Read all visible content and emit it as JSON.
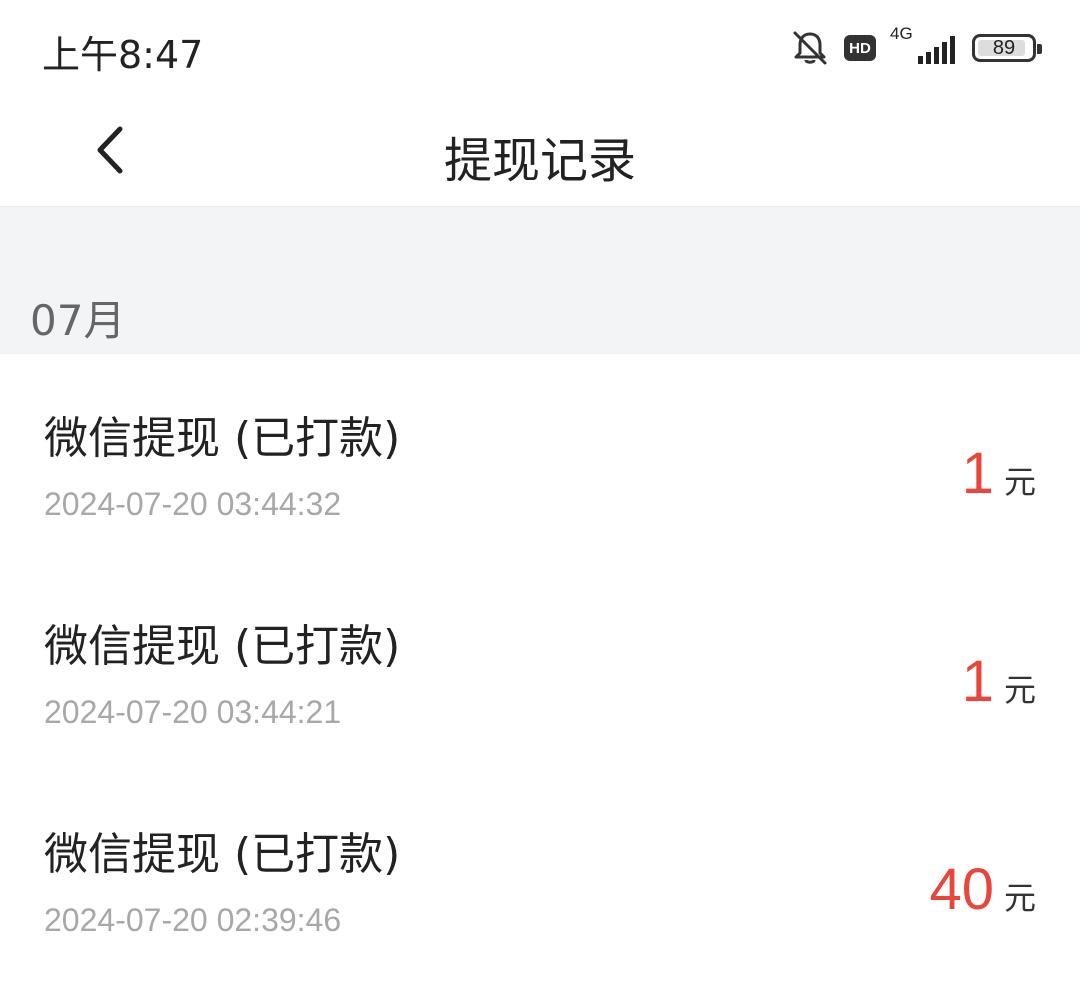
{
  "status_bar": {
    "time": "上午8:47",
    "hd_label": "HD",
    "network_label": "4G",
    "battery_level": "89",
    "icons": [
      "bell-muted-icon",
      "hd-icon",
      "signal-icon",
      "battery-icon"
    ]
  },
  "header": {
    "title": "提现记录",
    "back_icon": "chevron-left-icon"
  },
  "month_label": "07月",
  "records": [
    {
      "title": "微信提现 (已打款)",
      "time": "2024-07-20 03:44:32",
      "amount": "1",
      "unit": "元"
    },
    {
      "title": "微信提现 (已打款)",
      "time": "2024-07-20 03:44:21",
      "amount": "1",
      "unit": "元"
    },
    {
      "title": "微信提现 (已打款)",
      "time": "2024-07-20 02:39:46",
      "amount": "40",
      "unit": "元"
    }
  ],
  "colors": {
    "amount": "#e8463b",
    "section_background": "#f3f4f6",
    "timestamp": "#a8a8a8"
  }
}
